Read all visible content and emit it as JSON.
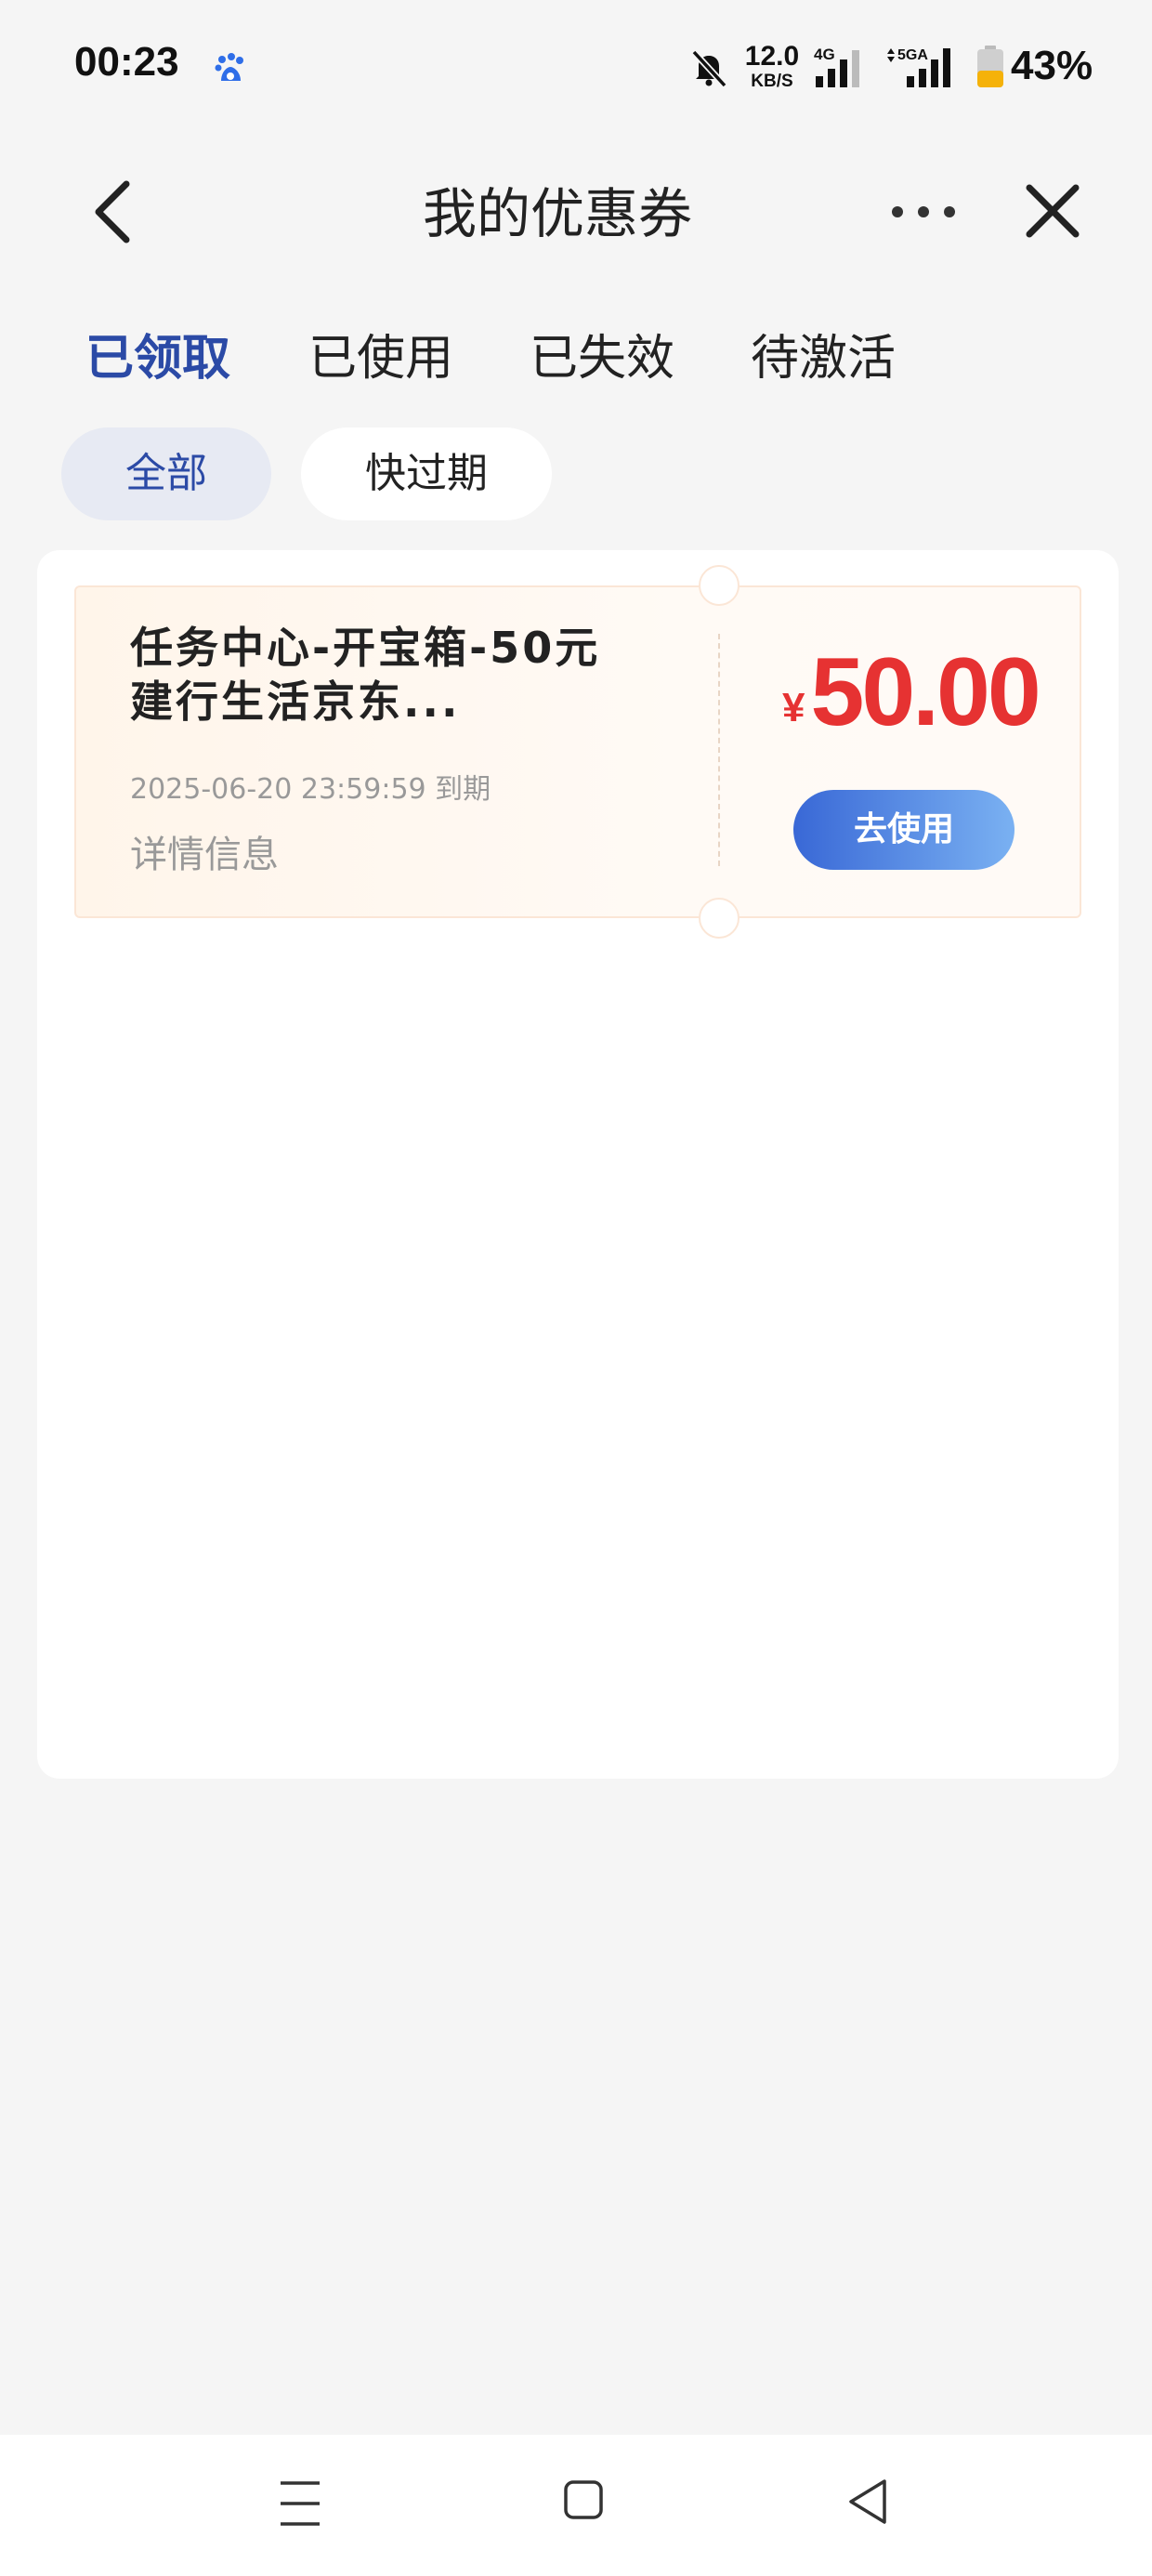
{
  "status_bar": {
    "time": "00:23",
    "net_speed_value": "12.0",
    "net_speed_unit": "KB/S",
    "net_4g_label": "4G",
    "net_5g_label": "5GA",
    "battery_percent": "43%",
    "battery_level": 0.43,
    "icons": [
      "baidu-icon",
      "mute-bell-icon",
      "signal-4g-icon",
      "signal-5g-icon",
      "battery-icon"
    ]
  },
  "nav": {
    "title": "我的优惠券"
  },
  "tabs": [
    {
      "label": "已领取",
      "active": true
    },
    {
      "label": "已使用",
      "active": false
    },
    {
      "label": "已失效",
      "active": false
    },
    {
      "label": "待激活",
      "active": false
    }
  ],
  "filters": [
    {
      "label": "全部",
      "selected": true
    },
    {
      "label": "快过期",
      "selected": false
    }
  ],
  "coupons": [
    {
      "title_line1": "任务中心-开宝箱-50元",
      "title_line2": "建行生活京东...",
      "expiry": "2025-06-20 23:59:59 到期",
      "details_label": "详情信息",
      "currency": "¥",
      "amount": "50.00",
      "action_label": "去使用"
    }
  ],
  "colors": {
    "accent_blue": "#2b4aa6",
    "amount_red": "#e63232",
    "button_gradient_start": "#3968d6",
    "button_gradient_end": "#7ab1f2",
    "battery_fill": "#f5b20a"
  }
}
